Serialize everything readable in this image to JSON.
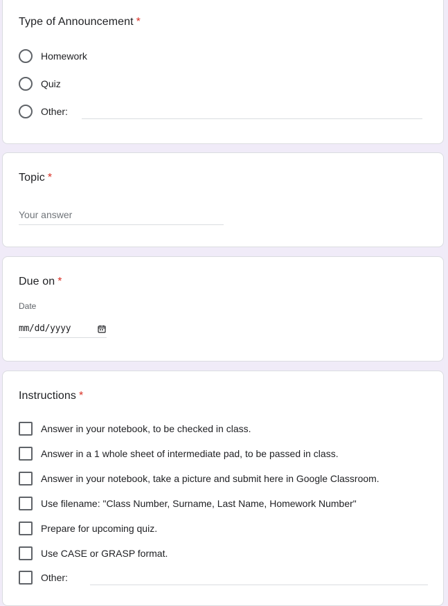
{
  "announcement_type": {
    "title": "Type of Announcement",
    "required_mark": "*",
    "options": [
      "Homework",
      "Quiz",
      "Other:"
    ]
  },
  "topic": {
    "title": "Topic",
    "required_mark": "*",
    "placeholder": "Your answer"
  },
  "due_on": {
    "title": "Due on",
    "required_mark": "*",
    "date_label": "Date",
    "date_placeholder": "mm/dd/yyyy"
  },
  "instructions": {
    "title": "Instructions",
    "required_mark": "*",
    "options": [
      "Answer in your notebook, to be checked in class.",
      "Answer in a 1 whole sheet of intermediate pad, to be passed in class.",
      "Answer in your notebook, take a picture and submit here in Google Classroom.",
      "Use filename: \"Class Number, Surname, Last Name, Homework Number\"",
      "Prepare for upcoming quiz.",
      "Use CASE or GRASP format.",
      "Other:"
    ]
  },
  "colors": {
    "background": "#f0ebf8",
    "required": "#d93025",
    "control_border": "#5f6368"
  },
  "icons": {
    "date_picker": "calendar-icon"
  }
}
